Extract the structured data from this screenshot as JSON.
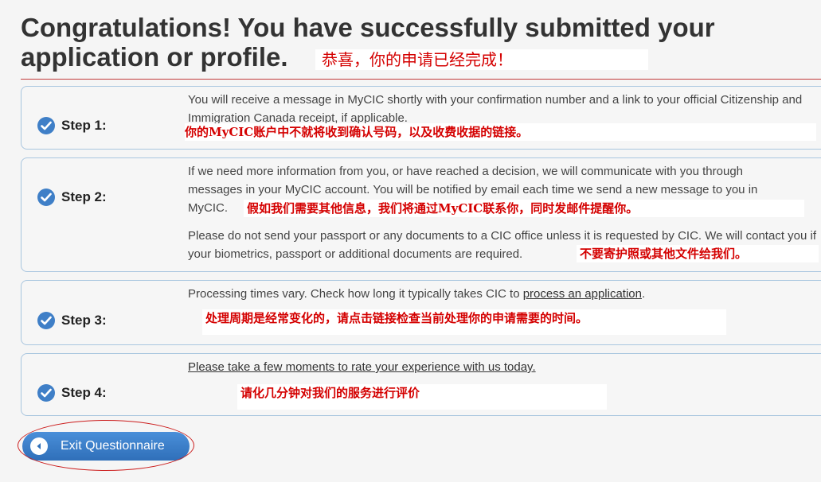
{
  "header": {
    "title_line1": "Congratulations! You have successfully submitted your",
    "title_line2": "application or profile.",
    "cn_note": "恭喜，你的申请已经完成！"
  },
  "steps": [
    {
      "label": "Step 1:",
      "text": "You will receive a message in MyCIC shortly with your confirmation number and a link to your official Citizenship and Immigration Canada receipt, if applicable.",
      "cn_note": "你的MyCIC账户中不就将收到确认号码，以及收费收据的链接。"
    },
    {
      "label": "Step 2:",
      "text_p1": "If we need more information from you, or have reached a decision, we will communicate with you through messages in your MyCIC account. You will be notified by email each time we send a new message to you in MyCIC.",
      "cn_note_1": "假如我们需要其他信息，我们将通过MyCIC联系你，同时发邮件提醒你。",
      "text_p2": "Please do not send your passport or any documents to a CIC office unless it is requested by CIC. We will contact you if your biometrics, passport or additional documents are required.",
      "cn_note_2": "不要寄护照或其他文件给我们。"
    },
    {
      "label": "Step 3:",
      "text_before": "Processing times vary. Check how long it typically takes CIC to ",
      "link": "process an application",
      "text_after": ".",
      "cn_note": "处理周期是经常变化的，请点击链接检查当前处理你的申请需要的时间。"
    },
    {
      "label": "Step 4:",
      "link": "Please take a few moments to rate your experience with us today.",
      "cn_note": "请化几分钟对我们的服务进行评价"
    }
  ],
  "exit_button": {
    "label": "Exit Questionnaire",
    "icon": "back-arrow-icon"
  },
  "colors": {
    "accent": "#3f7fc7",
    "annotation": "#d40000",
    "rule": "#c23b3b"
  }
}
